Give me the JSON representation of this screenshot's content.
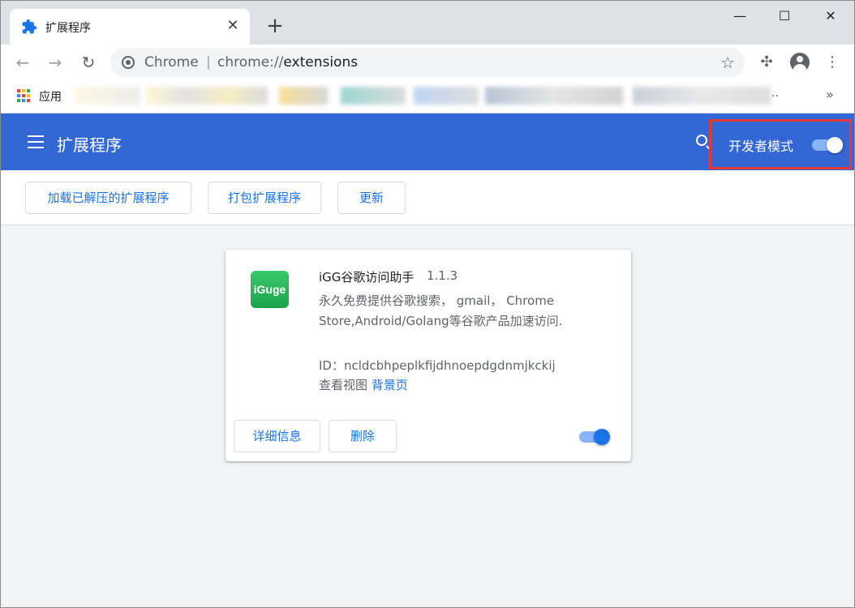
{
  "window": {
    "tab_title": "扩展程序",
    "tab_close_glyph": "✕",
    "newtab_glyph": "+",
    "minimize_glyph": "—",
    "maximize_glyph": "☐",
    "close_glyph": "✕"
  },
  "toolbar": {
    "back_glyph": "←",
    "forward_glyph": "→",
    "reload_glyph": "↻",
    "omnibox_prefix": "Chrome",
    "omnibox_sep": "|",
    "url_scheme": "chrome://",
    "url_host": "extensions",
    "star_glyph": "☆",
    "extensions_glyph": "✣",
    "menu_glyph": "⋮"
  },
  "bookmarks": {
    "apps_label": "应用",
    "apps_colors": [
      "#ea4335",
      "#fbbc05",
      "#34a853",
      "#4285f4",
      "#ea4335",
      "#fbbc05",
      "#34a853",
      "#4285f4",
      "#ea4335"
    ],
    "truncated": "..",
    "more_glyph": "»"
  },
  "header": {
    "title": "扩展程序",
    "dev_mode_label": "开发者模式"
  },
  "actions": {
    "load_unpacked": "加载已解压的扩展程序",
    "pack": "打包扩展程序",
    "update": "更新"
  },
  "extension": {
    "logo_text": "iGuge",
    "name": "iGG谷歌访问助手",
    "version": "1.1.3",
    "description": "永久免费提供谷歌搜索， gmail， Chrome Store,Android/Golang等谷歌产品加速访问.",
    "id": "ID：ncldcbhpeplkfijdhnoepdgdnmjkckij",
    "views_label": "查看视图",
    "background_page": "背景页",
    "details_button": "详细信息",
    "remove_button": "删除",
    "enabled": true
  },
  "colors": {
    "header_bg": "#3367d6",
    "accent": "#1a73e8",
    "highlight_border": "#e53935"
  }
}
